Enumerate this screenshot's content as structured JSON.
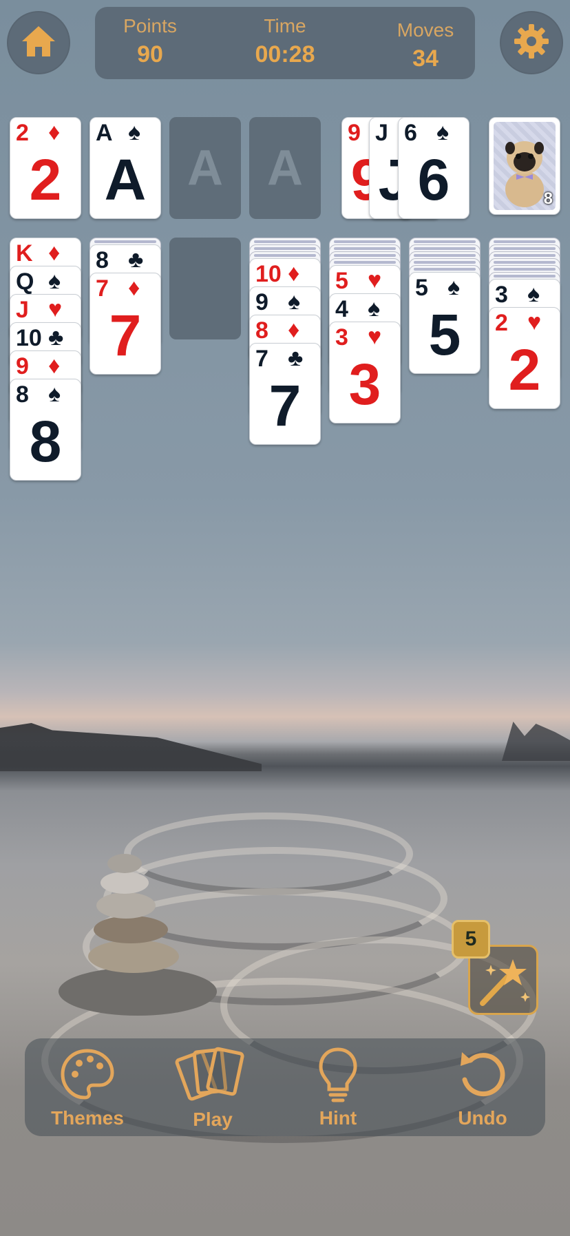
{
  "header": {
    "home_icon": "home-icon",
    "settings_icon": "gear-icon",
    "stats": [
      {
        "label": "Points",
        "value": "90"
      },
      {
        "label": "Time",
        "value": "00:28"
      },
      {
        "label": "Moves",
        "value": "34"
      }
    ]
  },
  "foundations": [
    {
      "rank": "2",
      "suit": "♦",
      "color": "red"
    },
    {
      "rank": "A",
      "suit": "♠",
      "color": "black"
    },
    {
      "empty_label": "A"
    },
    {
      "empty_label": "A"
    }
  ],
  "waste": [
    {
      "rank": "9",
      "suit": "♥",
      "color": "red"
    },
    {
      "rank": "J",
      "suit": "♠",
      "color": "black"
    },
    {
      "rank": "6",
      "suit": "♠",
      "color": "black"
    }
  ],
  "stock": {
    "count": "8",
    "back_image": "pug-card-back"
  },
  "tableau": [
    {
      "hidden": 0,
      "cards": [
        {
          "rank": "K",
          "suit": "♦",
          "color": "red"
        },
        {
          "rank": "Q",
          "suit": "♠",
          "color": "black"
        },
        {
          "rank": "J",
          "suit": "♥",
          "color": "red"
        },
        {
          "rank": "10",
          "suit": "♣",
          "color": "black"
        },
        {
          "rank": "9",
          "suit": "♦",
          "color": "red"
        },
        {
          "rank": "8",
          "suit": "♠",
          "color": "black"
        }
      ]
    },
    {
      "hidden": 1,
      "cards": [
        {
          "rank": "8",
          "suit": "♣",
          "color": "black"
        },
        {
          "rank": "7",
          "suit": "♦",
          "color": "red"
        }
      ]
    },
    {
      "hidden": 0,
      "cards": []
    },
    {
      "hidden": 3,
      "cards": [
        {
          "rank": "10",
          "suit": "♦",
          "color": "red"
        },
        {
          "rank": "9",
          "suit": "♠",
          "color": "black"
        },
        {
          "rank": "8",
          "suit": "♦",
          "color": "red"
        },
        {
          "rank": "7",
          "suit": "♣",
          "color": "black"
        }
      ]
    },
    {
      "hidden": 4,
      "cards": [
        {
          "rank": "5",
          "suit": "♥",
          "color": "red"
        },
        {
          "rank": "4",
          "suit": "♠",
          "color": "black"
        },
        {
          "rank": "3",
          "suit": "♥",
          "color": "red"
        }
      ]
    },
    {
      "hidden": 5,
      "cards": [
        {
          "rank": "5",
          "suit": "♠",
          "color": "black"
        }
      ]
    },
    {
      "hidden": 6,
      "cards": [
        {
          "rank": "3",
          "suit": "♠",
          "color": "black"
        },
        {
          "rank": "2",
          "suit": "♥",
          "color": "red"
        }
      ]
    }
  ],
  "magic_wand": {
    "count": "5",
    "icon": "magic-wand-icon"
  },
  "bottom_nav": [
    {
      "label": "Themes",
      "icon": "palette-icon"
    },
    {
      "label": "Play",
      "icon": "cards-icon"
    },
    {
      "label": "Hint",
      "icon": "lightbulb-icon"
    },
    {
      "label": "Undo",
      "icon": "undo-icon"
    }
  ],
  "colors": {
    "accent": "#e3a65b",
    "red_suit": "#e01e1e",
    "black_suit": "#0f1b2a",
    "panel": "#5d6b78"
  }
}
